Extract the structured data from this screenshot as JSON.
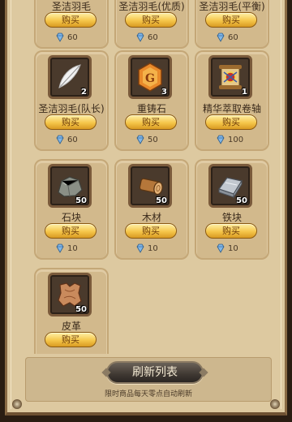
{
  "shop": {
    "top_row": [
      {
        "name": "圣洁羽毛",
        "buy": "购买",
        "price": "60"
      },
      {
        "name": "圣洁羽毛(优质)",
        "buy": "购买",
        "price": "60"
      },
      {
        "name": "圣洁羽毛(平衡)",
        "buy": "购买",
        "price": "60"
      }
    ],
    "items": [
      {
        "name": "圣洁羽毛(队长)",
        "qty": "2",
        "buy": "购买",
        "price": "60",
        "icon": "white-feather-icon"
      },
      {
        "name": "重铸石",
        "qty": "3",
        "buy": "购买",
        "price": "50",
        "icon": "reforge-stone-icon"
      },
      {
        "name": "精华萃取卷轴",
        "qty": "1",
        "buy": "购买",
        "price": "100",
        "icon": "essence-scroll-icon"
      },
      {
        "name": "石块",
        "qty": "50",
        "buy": "购买",
        "price": "10",
        "icon": "stone-icon"
      },
      {
        "name": "木材",
        "qty": "50",
        "buy": "购买",
        "price": "10",
        "icon": "wood-log-icon"
      },
      {
        "name": "铁块",
        "qty": "50",
        "buy": "购买",
        "price": "10",
        "icon": "iron-ingot-icon"
      },
      {
        "name": "皮革",
        "qty": "50",
        "buy": "购买",
        "price": "",
        "icon": "leather-icon"
      }
    ]
  },
  "footer": {
    "refresh_label": "刷新列表",
    "note": "限时商品每天零点自动刷新"
  },
  "colors": {
    "panel": "#ddc9a0",
    "card": "#d2b98c",
    "buy_button": "#f5c64a",
    "gem": "#7fb6e8"
  }
}
